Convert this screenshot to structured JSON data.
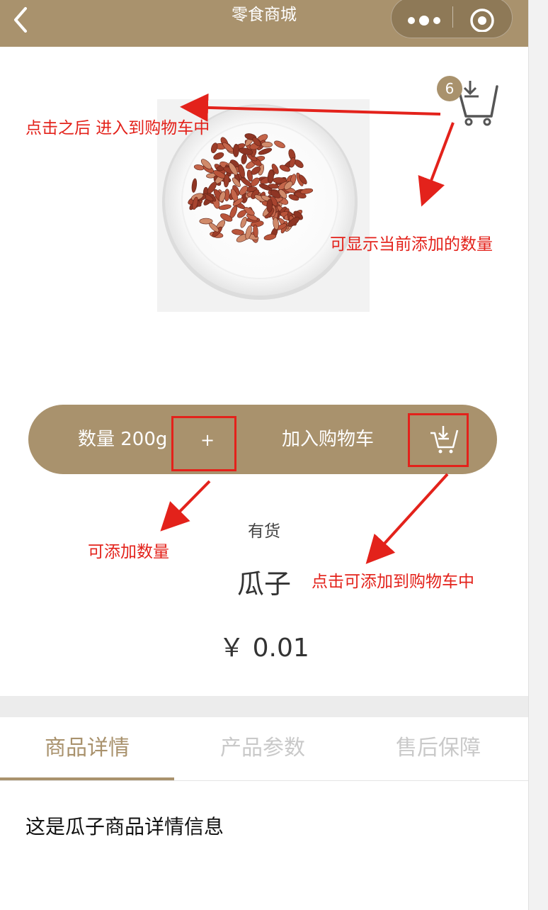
{
  "navbar": {
    "title": "零食商城"
  },
  "cart": {
    "badge_count": "6"
  },
  "annotations": {
    "enter_cart": "点击之后 进入到购物车中",
    "show_count": "可显示当前添加的数量",
    "add_quantity": "可添加数量",
    "add_to_cart": "点击可添加到购物车中"
  },
  "action_bar": {
    "quantity_label": "数量 200g",
    "plus_label": "+",
    "add_cart_label": "加入购物车"
  },
  "product": {
    "stock": "有货",
    "name": "瓜子",
    "price": "￥ 0.01",
    "detail_text": "这是瓜子商品详情信息"
  },
  "tabs": [
    {
      "label": "商品详情",
      "active": true
    },
    {
      "label": "产品参数",
      "active": false
    },
    {
      "label": "售后保障",
      "active": false
    }
  ],
  "colors": {
    "brand": "#a9926d",
    "annotation": "#e3221b"
  },
  "icons": [
    "back-arrow-icon",
    "more-dots-icon",
    "close-circle-icon",
    "cart-icon",
    "cart-add-icon"
  ]
}
